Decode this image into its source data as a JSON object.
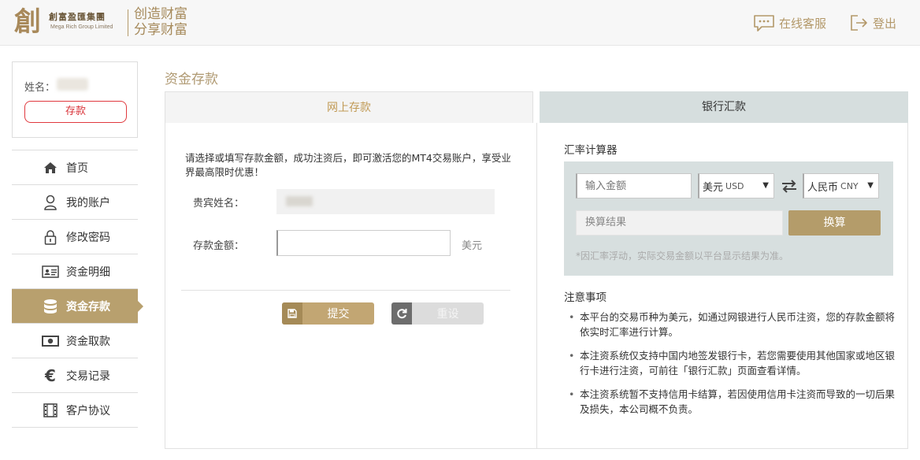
{
  "header": {
    "logo_glyph": "創",
    "company_cn": "創富盈匯集團",
    "company_en": "Mega Rich Group Limited",
    "slogan_line1": "创造财富",
    "slogan_line2": "分享财富",
    "service_label": "在线客服",
    "logout_label": "登出"
  },
  "sidebar": {
    "name_label": "姓名：",
    "deposit_button": "存款",
    "items": [
      {
        "label": "首页",
        "icon": "home-icon"
      },
      {
        "label": "我的账户",
        "icon": "user-icon"
      },
      {
        "label": "修改密码",
        "icon": "lock-icon"
      },
      {
        "label": "资金明细",
        "icon": "id-card-icon"
      },
      {
        "label": "资金存款",
        "icon": "database-icon",
        "active": true
      },
      {
        "label": "资金取款",
        "icon": "banknote-icon"
      },
      {
        "label": "交易记录",
        "icon": "euro-icon"
      },
      {
        "label": "客户协议",
        "icon": "film-icon"
      }
    ]
  },
  "page": {
    "title": "资金存款",
    "tabs": [
      {
        "label": "网上存款",
        "active": true
      },
      {
        "label": "银行汇款",
        "active": false
      }
    ]
  },
  "deposit_form": {
    "intro": "请选择或填写存款金额，成功注资后，即可激活您的MT4交易账户，享受业界最高限时优惠！",
    "name_label": "贵宾姓名：",
    "amount_label": "存款金额：",
    "amount_value": "",
    "unit": "美元",
    "submit_label": "提交",
    "reset_label": "重设"
  },
  "calculator": {
    "title": "汇率计算器",
    "amount_placeholder": "输入金额",
    "from_currency": "美元",
    "from_code": "USD",
    "to_currency": "人民币",
    "to_code": "CNY",
    "result_placeholder": "换算结果",
    "convert_label": "换算",
    "note": "*因汇率浮动，实际交易金额以平台显示结果为准。"
  },
  "notes": {
    "title": "注意事项",
    "items": [
      "本平台的交易币种为美元，如通过网银进行人民币注资，您的存款金额将依实时汇率进行计算。",
      "本注资系统仅支持中国内地签发银行卡，若您需要使用其他国家或地区银行卡进行注资，可前往「银行汇款」页面查看详情。",
      "本注资系统暂不支持信用卡结算，若因使用信用卡注资而导致的一切后果及损失，本公司概不负责。"
    ]
  },
  "colors": {
    "accent_gold": "#b8a06e",
    "deposit_red": "#d9343a",
    "bank_tab": "#d6dede"
  }
}
